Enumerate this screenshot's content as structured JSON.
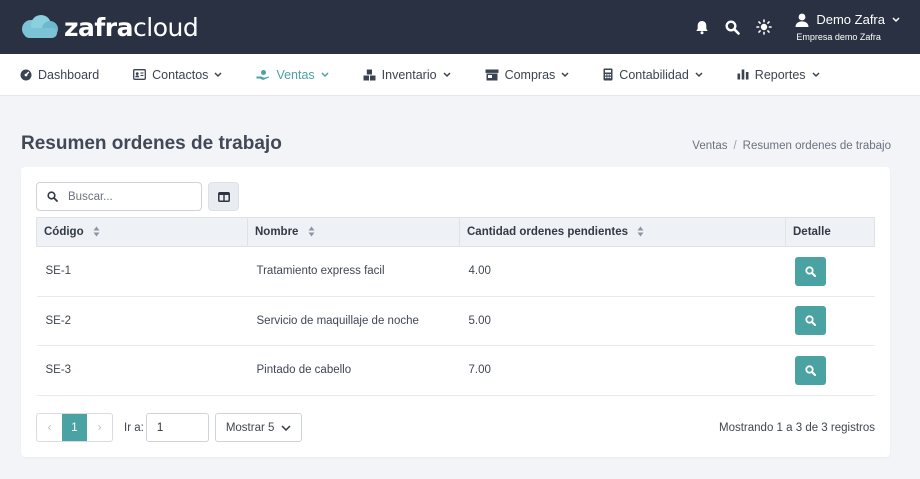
{
  "brand": {
    "bold": "zafra",
    "light": "cloud",
    "accent": "#4aa3a2",
    "header_bg": "#2a3142"
  },
  "header": {
    "icons": [
      "bell-icon",
      "search-icon",
      "sun-icon"
    ],
    "user_name": "Demo Zafra",
    "company": "Empresa demo Zafra"
  },
  "nav": [
    {
      "label": "Dashboard",
      "icon": "dashboard-icon",
      "dropdown": false,
      "active": false
    },
    {
      "label": "Contactos",
      "icon": "contacts-icon",
      "dropdown": true,
      "active": false
    },
    {
      "label": "Ventas",
      "icon": "sales-icon",
      "dropdown": true,
      "active": true
    },
    {
      "label": "Inventario",
      "icon": "inventory-icon",
      "dropdown": true,
      "active": false
    },
    {
      "label": "Compras",
      "icon": "store-icon",
      "dropdown": true,
      "active": false
    },
    {
      "label": "Contabilidad",
      "icon": "calculator-icon",
      "dropdown": true,
      "active": false
    },
    {
      "label": "Reportes",
      "icon": "bar-chart-icon",
      "dropdown": true,
      "active": false
    }
  ],
  "page": {
    "title": "Resumen ordenes de trabajo",
    "breadcrumb": [
      "Ventas",
      "Resumen ordenes de trabajo"
    ],
    "breadcrumb_sep": "/"
  },
  "search": {
    "placeholder": "Buscar...",
    "value": ""
  },
  "table": {
    "columns": [
      "Código",
      "Nombre",
      "Cantidad ordenes pendientes",
      "Detalle"
    ],
    "rows": [
      {
        "codigo": "SE-1",
        "nombre": "Tratamiento express facil",
        "cantidad": "4.00"
      },
      {
        "codigo": "SE-2",
        "nombre": "Servicio de maquillaje de noche",
        "cantidad": "5.00"
      },
      {
        "codigo": "SE-3",
        "nombre": "Pintado de cabello",
        "cantidad": "7.00"
      }
    ]
  },
  "pagination": {
    "prev": "‹",
    "current": "1",
    "next": "›",
    "goto_label": "Ir a:",
    "goto_value": "1",
    "page_size": "Mostrar 5",
    "summary": "Mostrando 1 a 3 de 3 registros"
  }
}
